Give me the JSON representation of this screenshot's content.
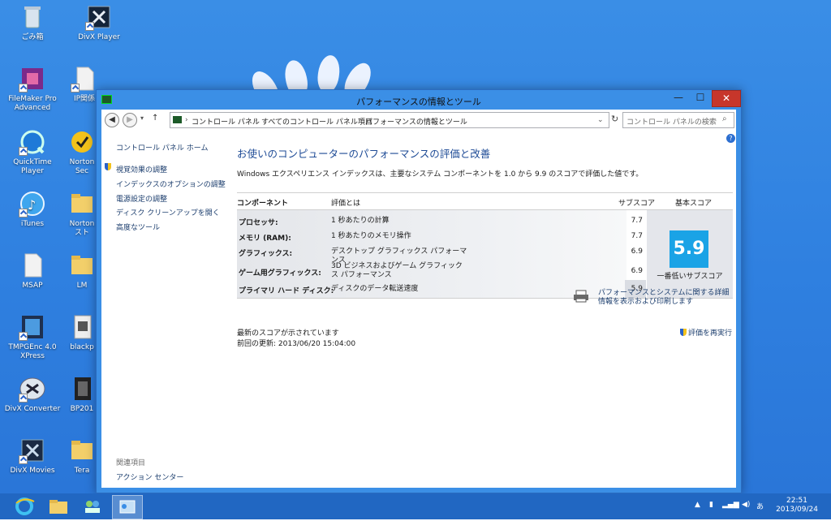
{
  "desktop": {
    "icons": [
      {
        "label": "ごみ箱",
        "icon": "recycle-bin-icon"
      },
      {
        "label": "DivX Player",
        "icon": "divx-player-icon"
      },
      {
        "label": "FileMaker Pro Advanced",
        "icon": "filemaker-icon"
      },
      {
        "label": "IP関係",
        "icon": "document-icon"
      },
      {
        "label": "QuickTime Player",
        "icon": "quicktime-icon"
      },
      {
        "label": "Norton Sec",
        "icon": "norton-icon"
      },
      {
        "label": "iTunes",
        "icon": "itunes-icon"
      },
      {
        "label": "Norton スト",
        "icon": "folder-icon"
      },
      {
        "label": "MSAP",
        "icon": "document-icon"
      },
      {
        "label": "LM",
        "icon": "folder-icon"
      },
      {
        "label": "TMPGEnc 4.0 XPress",
        "icon": "tmpgenc-icon"
      },
      {
        "label": "blackp",
        "icon": "video-icon"
      },
      {
        "label": "DivX Converter",
        "icon": "divx-converter-icon"
      },
      {
        "label": "BP201",
        "icon": "film-icon"
      },
      {
        "label": "DivX Movies",
        "icon": "divx-movies-icon"
      },
      {
        "label": "Tera",
        "icon": "folder-icon"
      }
    ]
  },
  "window": {
    "title": "パフォーマンスの情報とツール",
    "controls": {
      "minimize": "—",
      "maximize": "☐",
      "close": "✕"
    },
    "nav": {
      "back": "◀",
      "forward": "▶",
      "up": "↑",
      "breadcrumbs": [
        "コントロール パネル",
        "すべてのコントロール パネル項目",
        "パフォーマンスの情報とツール"
      ],
      "refresh": "↻",
      "search_placeholder": "コントロール パネルの検索"
    },
    "sidebar": {
      "home": "コントロール パネル ホーム",
      "links": [
        "視覚効果の調整",
        "インデックスのオプションの調整",
        "電源設定の調整",
        "ディスク クリーンアップを開く",
        "高度なツール"
      ],
      "see_also_heading": "関連項目",
      "see_also_links": [
        "アクション センター"
      ]
    },
    "main": {
      "heading": "お使いのコンピューターのパフォーマンスの評価と改善",
      "description": "Windows エクスペリエンス インデックスは、主要なシステム コンポーネントを 1.0 から 9.9 のスコアで評価した値です。",
      "columns": {
        "component": "コンポーネント",
        "rated": "評価とは",
        "subscore": "サブスコア",
        "base": "基本スコア"
      },
      "rows": [
        {
          "component": "プロセッサ:",
          "rated": "1 秒あたりの計算",
          "subscore": "7.7"
        },
        {
          "component": "メモリ (RAM):",
          "rated": "1 秒あたりのメモリ操作",
          "subscore": "7.7"
        },
        {
          "component": "グラフィックス:",
          "rated": "デスクトップ グラフィックス パフォーマンス",
          "subscore": "6.9"
        },
        {
          "component": "ゲーム用グラフィックス:",
          "rated": "3D ビジネスおよびゲーム グラフィックス パフォーマンス",
          "subscore": "6.9"
        },
        {
          "component": "プライマリ ハード ディスク:",
          "rated": "ディスクのデータ転送速度",
          "subscore": "5.9"
        }
      ],
      "base_score": "5.9",
      "base_caption": "一番低いサブスコア",
      "print_link": "パフォーマンスとシステムに関する詳細情報を表示および印刷します",
      "status_line": "最新のスコアが示されています",
      "last_update": "前回の更新: 2013/06/20 15:04:00",
      "rerun": "評価を再実行"
    }
  },
  "taskbar": {
    "tray_text": "あ",
    "time": "22:51",
    "date": "2013/09/24"
  }
}
